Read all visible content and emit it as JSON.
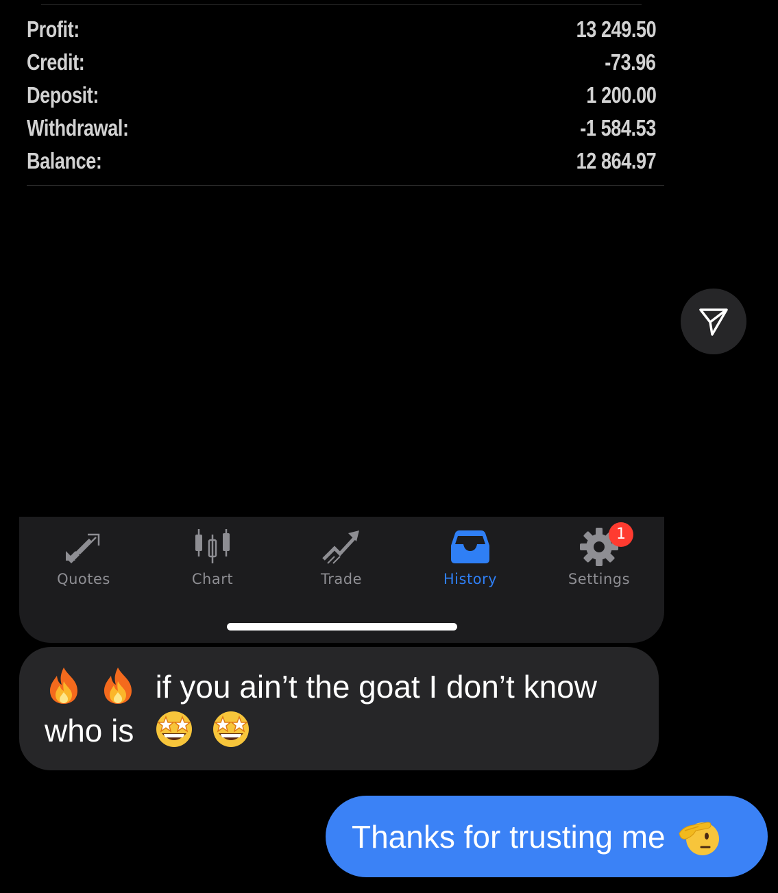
{
  "summary": {
    "rows": [
      {
        "label": "Profit:",
        "value": "13 249.50"
      },
      {
        "label": "Credit:",
        "value": "-73.96"
      },
      {
        "label": "Deposit:",
        "value": "1 200.00"
      },
      {
        "label": "Withdrawal:",
        "value": "-1 584.53"
      },
      {
        "label": "Balance:",
        "value": "12 864.97"
      }
    ]
  },
  "tab_bar": {
    "tabs": [
      {
        "label": "Quotes",
        "icon": "quotes-arrows-icon"
      },
      {
        "label": "Chart",
        "icon": "candlestick-icon"
      },
      {
        "label": "Trade",
        "icon": "trade-trend-icon"
      },
      {
        "label": "History",
        "icon": "inbox-tray-icon",
        "active": true
      },
      {
        "label": "Settings",
        "icon": "gear-icon",
        "badge": "1"
      }
    ],
    "active_color": "#2f7ff5",
    "inactive_color": "#8e8e93",
    "badge_color": "#ff3b30"
  },
  "share_button": {
    "icon": "send-icon"
  },
  "messages": {
    "received": {
      "text": "if you ain’t the goat I don’t know who is",
      "leading_emoji": [
        "fire-emoji",
        "fire-emoji"
      ],
      "trailing_emoji": [
        "star-struck-emoji",
        "star-struck-emoji"
      ]
    },
    "sent": {
      "text": "Thanks for trusting me",
      "trailing_emoji": [
        "saluting-face-emoji"
      ],
      "bubble_color": "#3b82f6"
    }
  }
}
